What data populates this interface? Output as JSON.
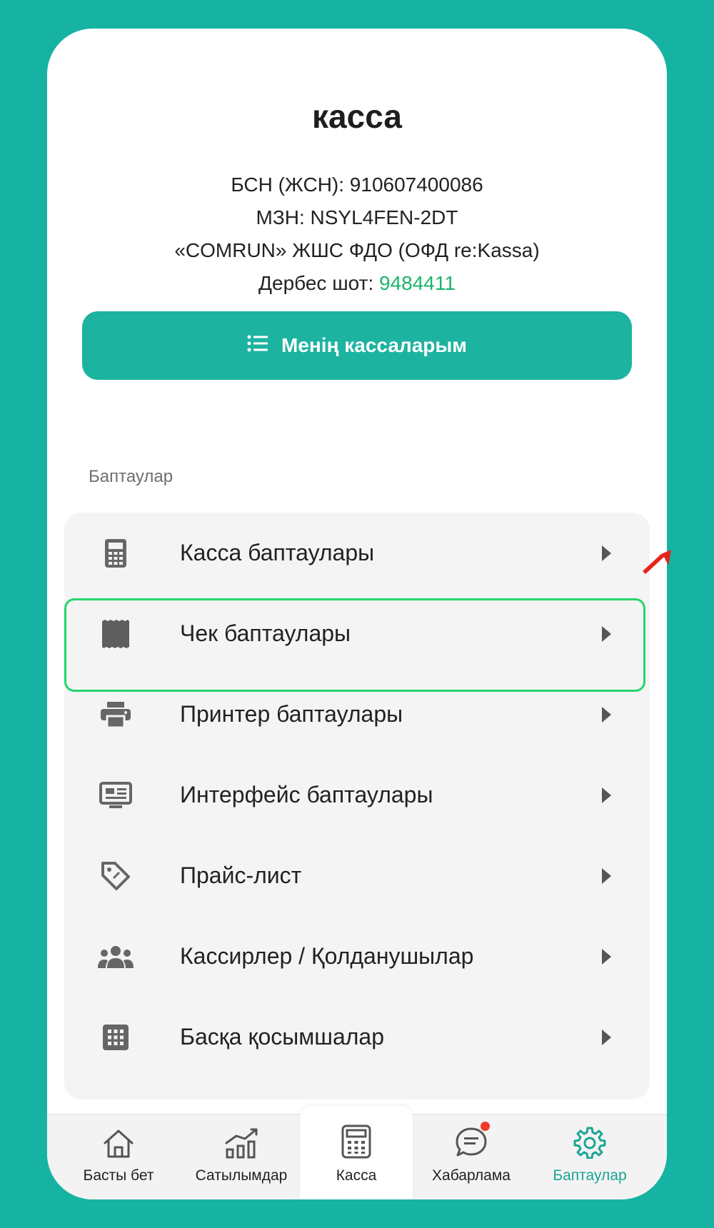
{
  "header": {
    "title": "касса",
    "bin_line": "БСН (ЖСН): 910607400086",
    "mzn_line": "МЗН: NSYL4FEN-2DT",
    "ofd_line": "«COMRUN» ЖШС ФДО (ОФД re:Kassa)",
    "account_label": "Дербес шот: ",
    "account_number": "9484411"
  },
  "my_kassas_button": {
    "label": "Менің кассаларым",
    "icon": "list-icon"
  },
  "settings": {
    "section_label": "Баптаулар",
    "items": [
      {
        "label": "Касса баптаулары",
        "icon": "calculator-icon"
      },
      {
        "label": "Чек баптаулары",
        "icon": "receipt-icon"
      },
      {
        "label": "Принтер баптаулары",
        "icon": "printer-icon"
      },
      {
        "label": "Интерфейс баптаулары",
        "icon": "monitor-icon"
      },
      {
        "label": "Прайс-лист",
        "icon": "price-tag-icon"
      },
      {
        "label": "Кассирлер / Қолданушылар",
        "icon": "users-icon"
      },
      {
        "label": "Басқа қосымшалар",
        "icon": "apps-grid-icon"
      }
    ]
  },
  "bottom_nav": {
    "items": [
      {
        "label": "Басты бет",
        "icon": "home-icon"
      },
      {
        "label": "Сатылымдар",
        "icon": "bar-chart-icon"
      },
      {
        "label": "Касса",
        "icon": "calculator-icon"
      },
      {
        "label": "Хабарлама",
        "icon": "chat-icon"
      },
      {
        "label": "Баптаулар",
        "icon": "gear-icon"
      }
    ],
    "active_index": 4
  },
  "colors": {
    "background": "#16b3a3",
    "accent": "#1db3a1",
    "account_number": "#1bb46b",
    "highlight_border": "#24d56f",
    "notification_dot": "#f03a2e",
    "arrow": "#e8231a"
  }
}
